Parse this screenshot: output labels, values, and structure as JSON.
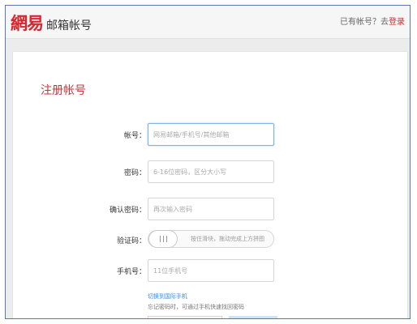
{
  "header": {
    "logo_mark": "網易",
    "logo_text": "邮箱帐号",
    "has_account_text": "已有帐号？去",
    "login_link": "登录"
  },
  "form": {
    "title": "注册帐号",
    "account": {
      "label": "帐号：",
      "placeholder": "网易邮箱/手机号/其他邮箱"
    },
    "password": {
      "label": "密码：",
      "placeholder": "6-16位密码，区分大小写"
    },
    "confirm_password": {
      "label": "确认密码：",
      "placeholder": "再次输入密码"
    },
    "captcha": {
      "label": "验证码：",
      "slider_text": "按住滑块，拖动完成上方拼图"
    },
    "phone": {
      "label": "手机号：",
      "placeholder": "11位手机号"
    },
    "switch_intl_link": "切换到国际手机",
    "phone_hint": "忘记密码时，可通过手机快速找回密码"
  }
}
